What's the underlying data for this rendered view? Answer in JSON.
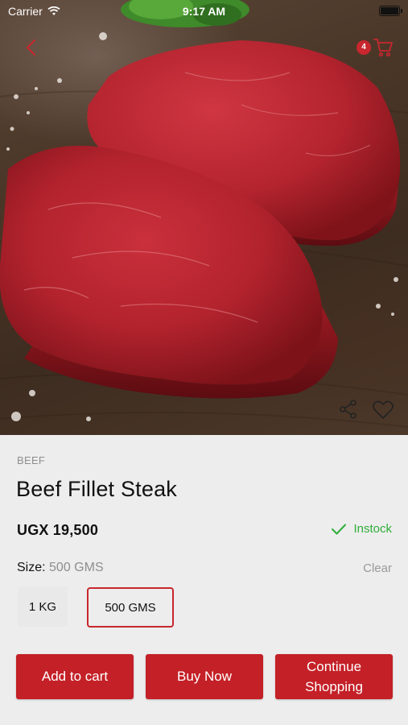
{
  "status_bar": {
    "carrier": "Carrier",
    "time": "9:17 AM"
  },
  "header": {
    "cart_count": "4"
  },
  "icons": {
    "back": "chevron-left-icon",
    "cart": "shopping-cart-icon",
    "share": "share-icon",
    "favorite": "heart-icon",
    "instock": "check-icon",
    "wifi": "wifi-icon",
    "battery": "battery-icon"
  },
  "colors": {
    "accent": "#c42027",
    "instock": "#2fae3a",
    "muted": "#8e8e8e",
    "panel": "#ededed"
  },
  "product": {
    "category": "BEEF",
    "name": "Beef Fillet Steak",
    "price": "UGX 19,500",
    "stock_status": "Instock",
    "size_label": "Size:",
    "size_value": "500 GMS",
    "clear_label": "Clear",
    "options": [
      {
        "label": "1 KG",
        "selected": false
      },
      {
        "label": "500 GMS",
        "selected": true
      }
    ]
  },
  "actions": {
    "add_to_cart": "Add to cart",
    "buy_now": "Buy Now",
    "continue_shopping": "Continue\nShopping"
  }
}
